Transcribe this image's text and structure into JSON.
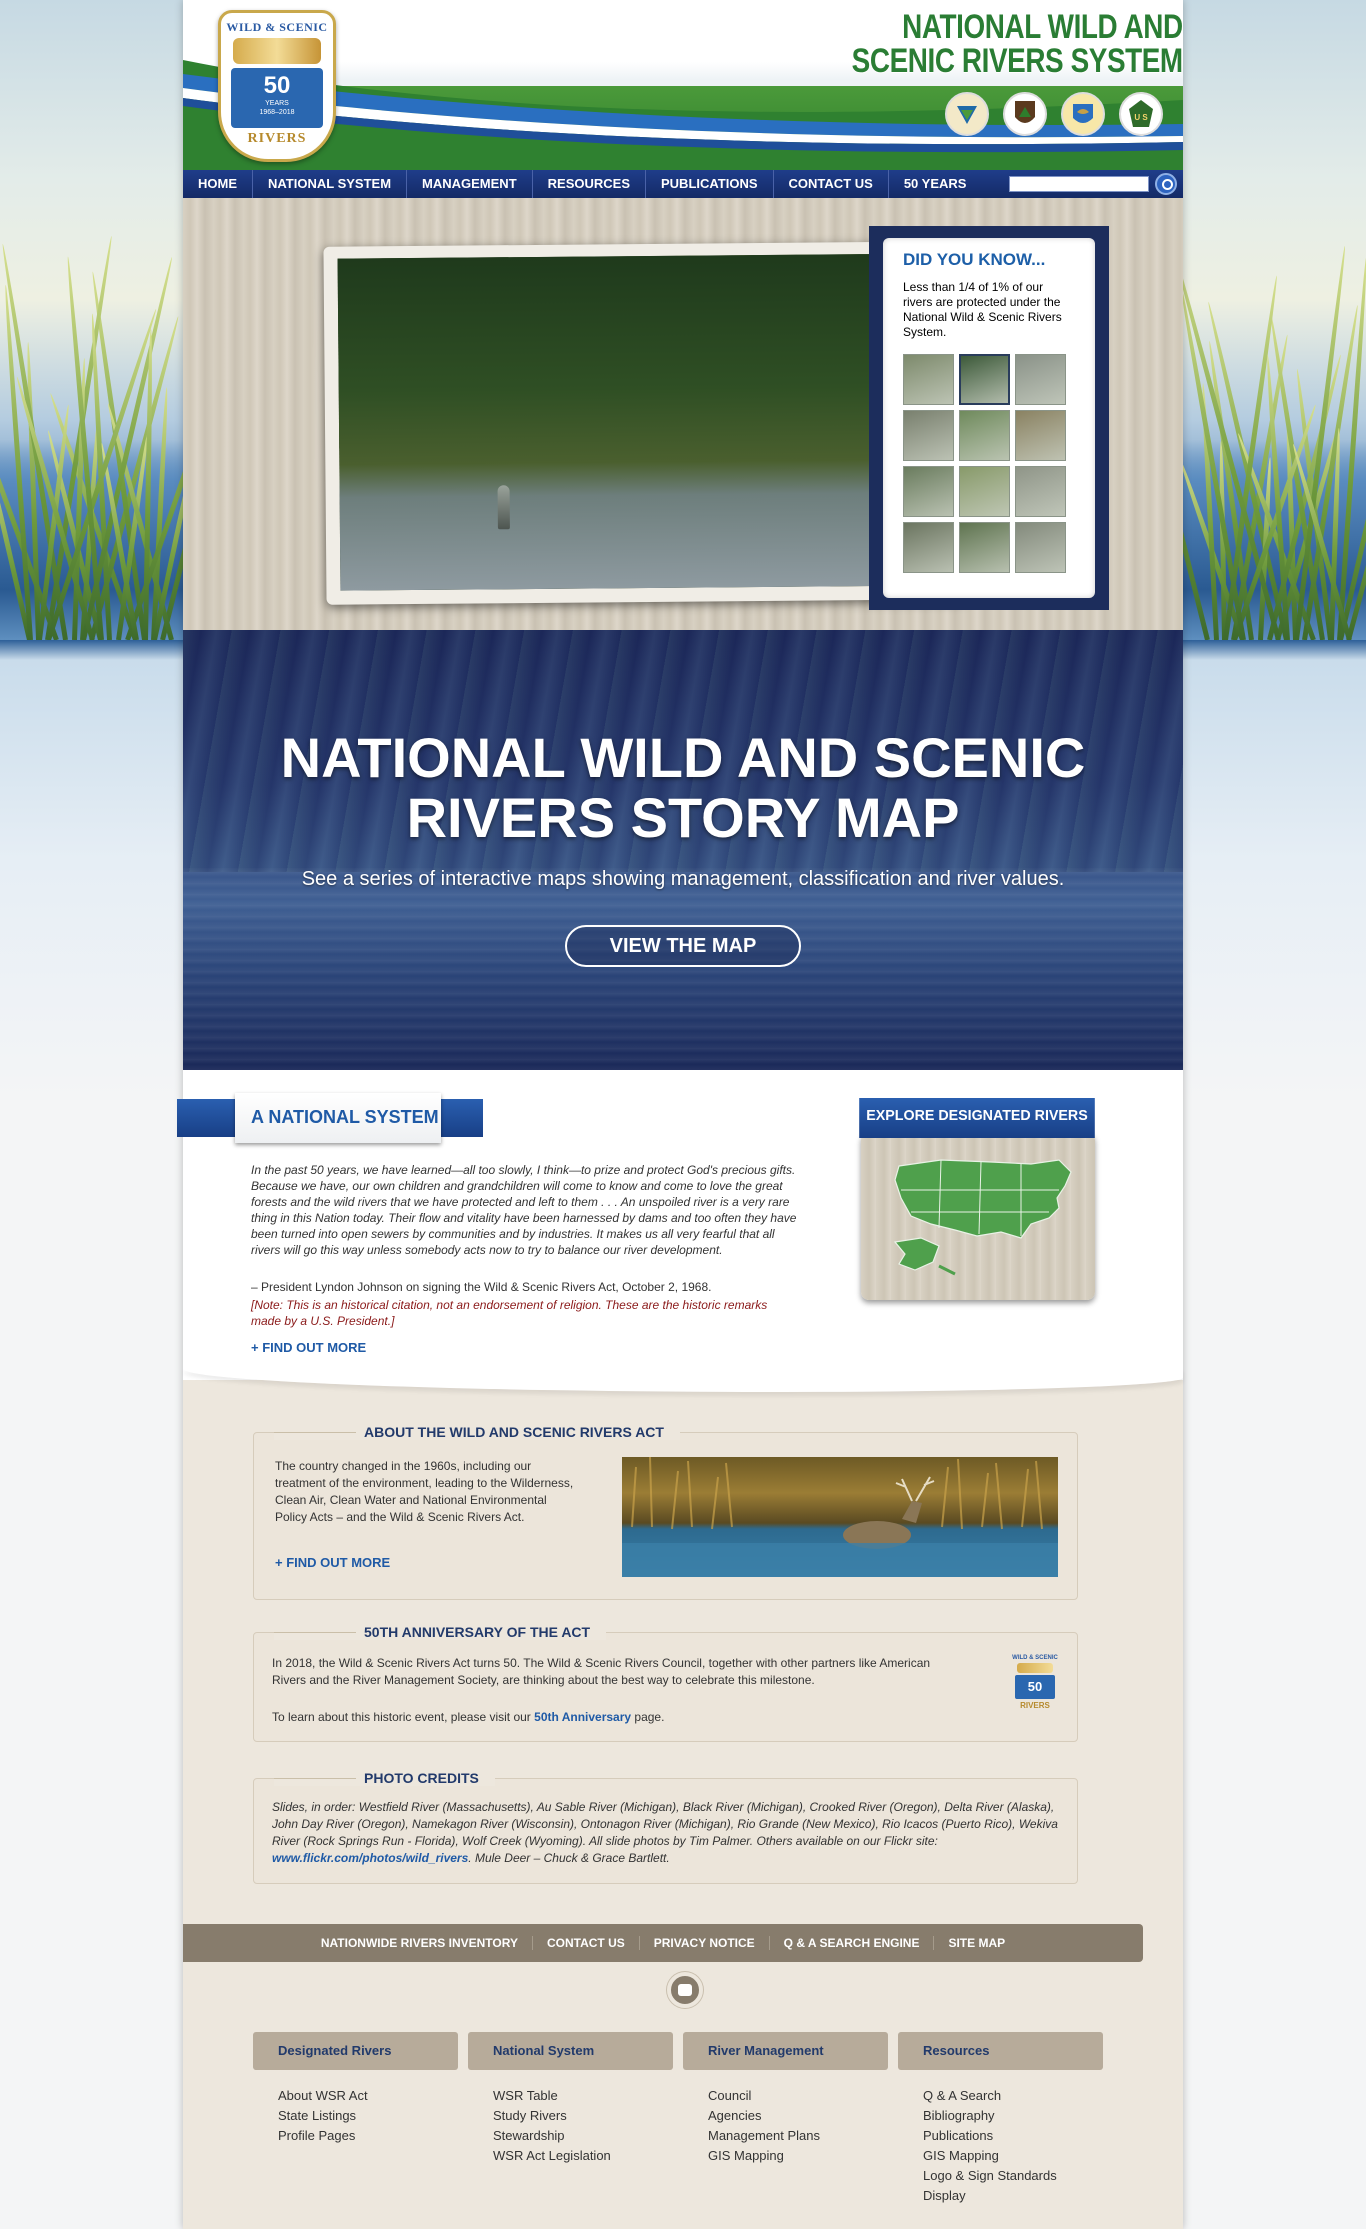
{
  "header": {
    "site_title_line1": "NATIONAL WILD AND",
    "site_title_line2": "SCENIC RIVERS SYSTEM",
    "logo": {
      "top_text": "WILD & SCENIC",
      "number": "50",
      "years": "YEARS",
      "dates": "1968–2018",
      "bottom_text": "RIVERS"
    },
    "agency_logos": [
      "blm-icon",
      "nps-icon",
      "fws-icon",
      "usfs-icon"
    ],
    "agency_usfs_text": "U S"
  },
  "nav": {
    "items": [
      {
        "label": "HOME"
      },
      {
        "label": "NATIONAL SYSTEM"
      },
      {
        "label": "MANAGEMENT"
      },
      {
        "label": "RESOURCES"
      },
      {
        "label": "PUBLICATIONS"
      },
      {
        "label": "CONTACT US"
      },
      {
        "label": "50 YEARS"
      }
    ],
    "search_value": ""
  },
  "did_you_know": {
    "title": "DID YOU KNOW...",
    "text": "Less than 1/4 of 1% of our rivers are protected under the National Wild & Scenic Rivers System.",
    "thumbnail_count": 12,
    "active_thumbnail": 2
  },
  "story_map": {
    "title_line1": "NATIONAL WILD AND SCENIC",
    "title_line2": "RIVERS STORY MAP",
    "subtitle": "See a series of interactive maps showing management, classification and river values.",
    "button": "VIEW THE MAP"
  },
  "national_system": {
    "heading": "A NATIONAL SYSTEM",
    "quote": "In the past 50 years, we have learned—all too slowly, I think—to prize and protect God's precious gifts. Because we have, our own children and grandchildren will come to know and come to love the great forests and the wild rivers that we have protected and left to them . . . An unspoiled river is a very rare thing in this Nation today. Their flow and vitality have been harnessed by dams and too often they have been turned into open sewers by communities and by industries. It makes us all very fearful that all rivers will go this way unless somebody acts now to try to balance our river development.",
    "source": "– President Lyndon Johnson on signing the Wild & Scenic Rivers Act, October 2, 1968.",
    "note": "[Note: This is an historical citation, not an endorsement of religion. These are the historic remarks made by a U.S. President.]",
    "find_more": "+ FIND OUT MORE",
    "explore_label": "EXPLORE DESIGNATED RIVERS"
  },
  "about_act": {
    "title": "ABOUT THE WILD AND SCENIC RIVERS ACT",
    "text": "The country changed in the 1960s, including our treatment of the environment, leading to the Wilderness, Clean Air, Clean Water and National Environmental Policy Acts – and the Wild & Scenic Rivers Act.",
    "find_more": "+ FIND OUT MORE"
  },
  "anniversary": {
    "title": "50TH ANNIVERSARY OF THE ACT",
    "text": "In 2018, the Wild & Scenic Rivers Act turns 50. The Wild & Scenic Rivers Council, together with other partners like American Rivers and the River Management Society, are thinking about the best way to celebrate this milestone.",
    "p2_before": "To learn about this historic event, please visit our ",
    "p2_link": "50th Anniversary",
    "p2_after": " page.",
    "logo_top": "WILD & SCENIC",
    "logo_number": "50",
    "logo_bottom": "RIVERS"
  },
  "photo_credits": {
    "title": "PHOTO CREDITS",
    "text": "Slides, in order: Westfield River (Massachusetts), Au Sable River (Michigan), Black River (Michigan), Crooked River (Oregon), Delta River (Alaska), John Day River (Oregon), Namekagon River (Wisconsin), Ontonagon River (Michigan), Rio Grande (New Mexico), Rio Icacos (Puerto Rico), Wekiva River (Rock Springs Run - Florida), Wolf Creek (Wyoming). All slide photos by Tim Palmer. Others available on our Flickr site: ",
    "link": "www.flickr.com/photos/wild_rivers",
    "after": ". Mule Deer – Chuck & Grace Bartlett."
  },
  "footer": {
    "links": [
      "NATIONWIDE RIVERS INVENTORY",
      "CONTACT US",
      "PRIVACY NOTICE",
      "Q & A SEARCH ENGINE",
      "SITE MAP"
    ],
    "columns": [
      {
        "heading": "Designated Rivers",
        "items": [
          "About WSR Act",
          "State Listings",
          "Profile Pages"
        ]
      },
      {
        "heading": "National System",
        "items": [
          "WSR Table",
          "Study Rivers",
          "Stewardship",
          "WSR Act Legislation"
        ]
      },
      {
        "heading": "River Management",
        "items": [
          "Council",
          "Agencies",
          "Management Plans",
          "GIS Mapping"
        ]
      },
      {
        "heading": "Resources",
        "items": [
          "Q & A Search",
          "Bibliography",
          "Publications",
          "GIS Mapping",
          "Logo & Sign Standards",
          "Display"
        ]
      }
    ]
  },
  "colors": {
    "nav_blue": "#1f3d8a",
    "title_green": "#2a7d34",
    "link_blue": "#1f5aa6",
    "note_red": "#8b1a1a",
    "footer_brown": "#877c6c"
  }
}
